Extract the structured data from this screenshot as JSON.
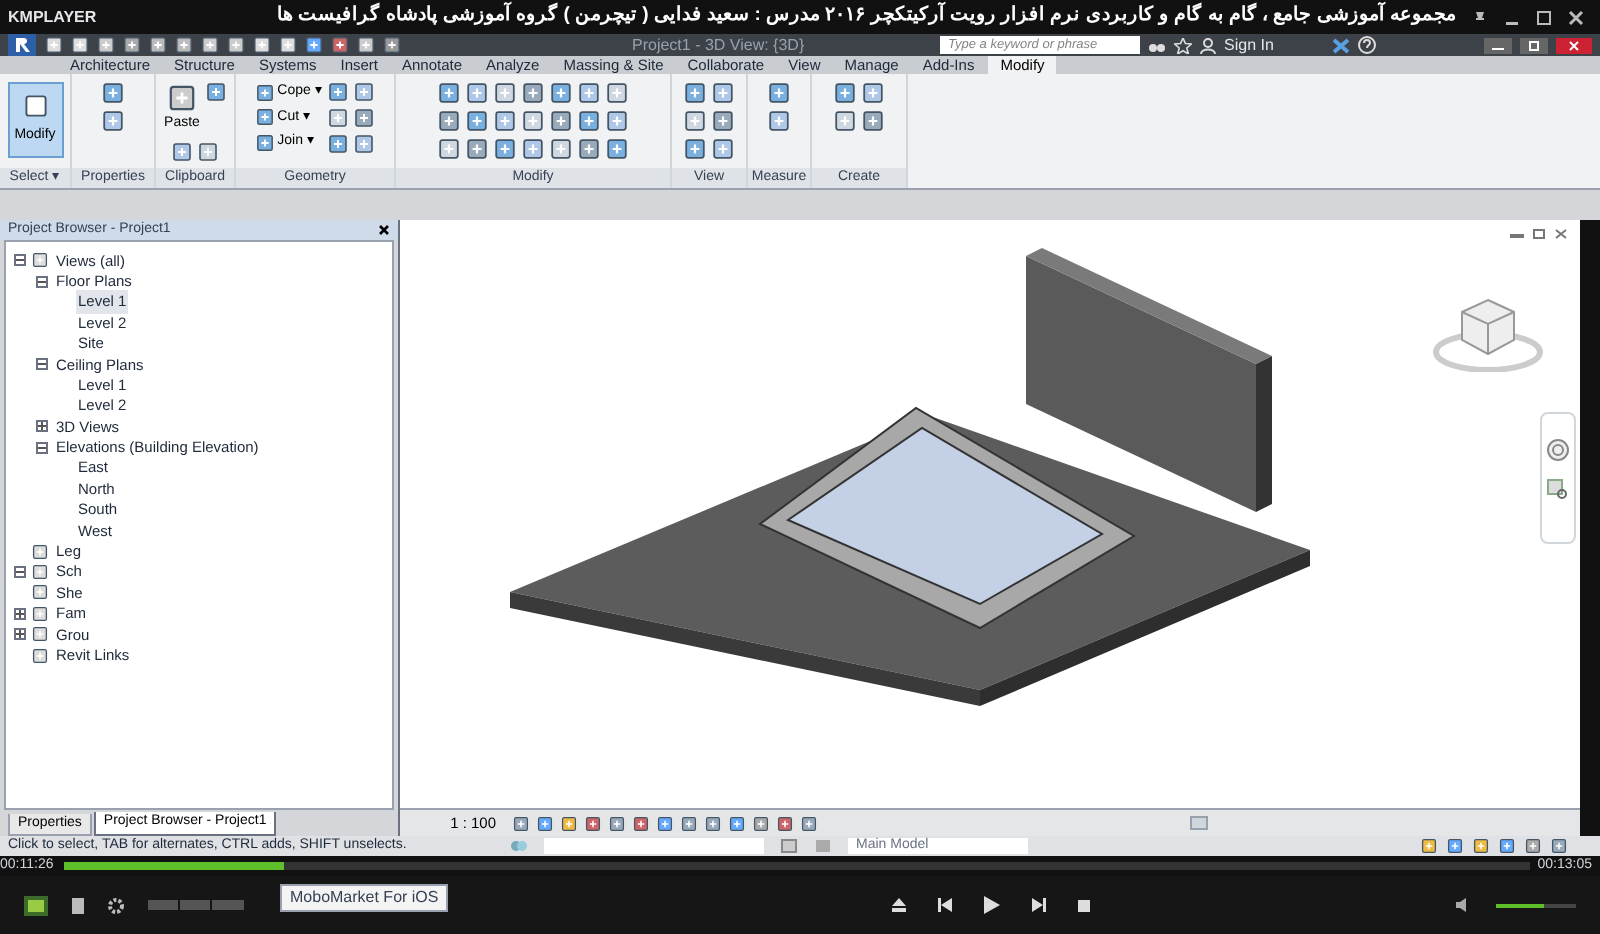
{
  "player": {
    "logo": "KMPLAYER",
    "title": "مجموعه آموزشی جامع ، گام به گام و کاربردی نرم افزار رویت آرکیتکچر ۲۰۱۶   مدرس : سعید فدایی ( تیچرمن ) گروه آموزشی پادشاه گرافیست ها",
    "elapsed": "00:11:26",
    "total": "00:13:05",
    "progress": {
      "level": 0.15
    },
    "volume": {
      "level": 0.6
    },
    "tooltip": "MoboMarket For iOS"
  },
  "revit": {
    "view_title": "Project1 - 3D View: {3D}",
    "search": {
      "placeholder": "Type a keyword or phrase"
    },
    "sign_in": "Sign In"
  },
  "tabs": [
    {
      "label": "Architecture",
      "selected": false
    },
    {
      "label": "Structure",
      "selected": false
    },
    {
      "label": "Systems",
      "selected": false
    },
    {
      "label": "Insert",
      "selected": false
    },
    {
      "label": "Annotate",
      "selected": false
    },
    {
      "label": "Analyze",
      "selected": false
    },
    {
      "label": "Massing & Site",
      "selected": false
    },
    {
      "label": "Collaborate",
      "selected": false
    },
    {
      "label": "View",
      "selected": false
    },
    {
      "label": "Manage",
      "selected": false
    },
    {
      "label": "Add-Ins",
      "selected": false
    },
    {
      "label": "Modify",
      "selected": true
    }
  ],
  "panels": [
    {
      "kind": "select",
      "label": "Select ▾",
      "tool": "Modify"
    },
    {
      "kind": "properties",
      "label": "Properties"
    },
    {
      "kind": "clipboard",
      "label": "Clipboard",
      "tool": "Paste"
    },
    {
      "kind": "geometry",
      "label": "Geometry",
      "tools": [
        "Cope ▾",
        "Cut ▾",
        "Join ▾"
      ]
    },
    {
      "kind": "modify",
      "label": "Modify"
    },
    {
      "kind": "view",
      "label": "View"
    },
    {
      "kind": "measure",
      "label": "Measure"
    },
    {
      "kind": "create",
      "label": "Create"
    }
  ],
  "browser": {
    "title": "Project Browser - Project1",
    "tree": [
      {
        "label": "Views (all)",
        "expanded": true,
        "children": [
          {
            "label": "Floor Plans",
            "expanded": true,
            "children": [
              {
                "label": "Level 1",
                "selected": true
              },
              {
                "label": "Level 2",
                "selected": false
              },
              {
                "label": "Site",
                "selected": false
              }
            ]
          },
          {
            "label": "Ceiling Plans",
            "expanded": true,
            "children": [
              {
                "label": "Level 1",
                "selected": false
              },
              {
                "label": "Level 2",
                "selected": false
              }
            ]
          },
          {
            "label": "3D Views",
            "expanded": false
          },
          {
            "label": "Elevations (Building Elevation)",
            "expanded": true,
            "children": [
              {
                "label": "East",
                "selected": false
              },
              {
                "label": "North",
                "selected": false
              },
              {
                "label": "South",
                "selected": false
              },
              {
                "label": "West",
                "selected": false
              }
            ]
          }
        ]
      },
      {
        "label": "Leg"
      },
      {
        "label": "Sch",
        "expanded": true
      },
      {
        "label": "She"
      },
      {
        "label": "Fam",
        "expanded": false
      },
      {
        "label": "Grou",
        "expanded": false
      },
      {
        "label": "Revit Links"
      }
    ]
  },
  "bottom_tabs": [
    {
      "label": "Properties",
      "selected": false
    },
    {
      "label": "Project Browser - Project1",
      "selected": true
    }
  ],
  "view_bar": {
    "scale": "1 : 100"
  },
  "status_bar": {
    "message": "Click to select, TAB for alternates, CTRL adds, SHIFT unselects.",
    "workset": "Main Model"
  }
}
